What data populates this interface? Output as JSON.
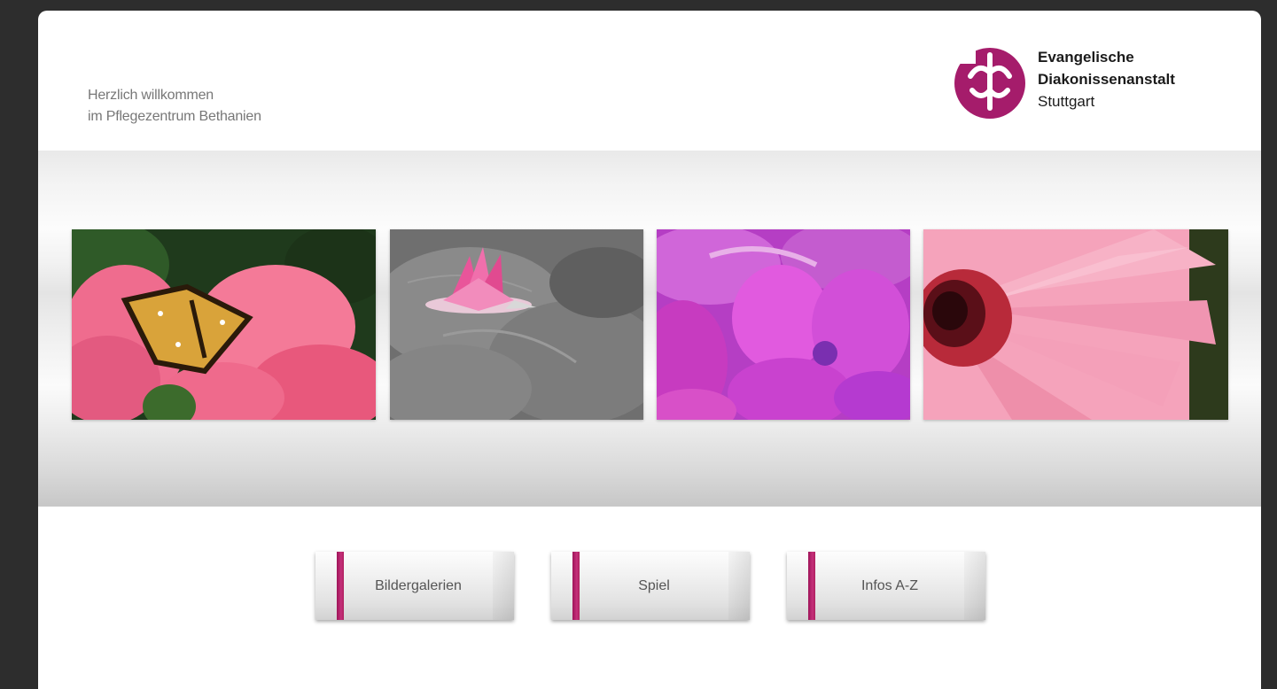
{
  "header": {
    "welcome_line1": "Herzlich willkommen",
    "welcome_line2": "im Pflegezentrum Bethanien"
  },
  "logo": {
    "line1": "Evangelische",
    "line2": "Diakonissenanstalt",
    "line3": "Stuttgart",
    "color": "#a51c6b"
  },
  "photos": [
    {
      "subject": "butterfly on pink flowers"
    },
    {
      "subject": "pink water lily on grey water"
    },
    {
      "subject": "purple phlox blossom"
    },
    {
      "subject": "pink gerbera close-up"
    }
  ],
  "nav": {
    "buttons": [
      {
        "label": "Bildergalerien"
      },
      {
        "label": "Spiel"
      },
      {
        "label": "Infos A-Z"
      }
    ]
  },
  "colors": {
    "accent": "#b3246d",
    "background": "#2d2d2d",
    "panel": "#ffffff"
  }
}
